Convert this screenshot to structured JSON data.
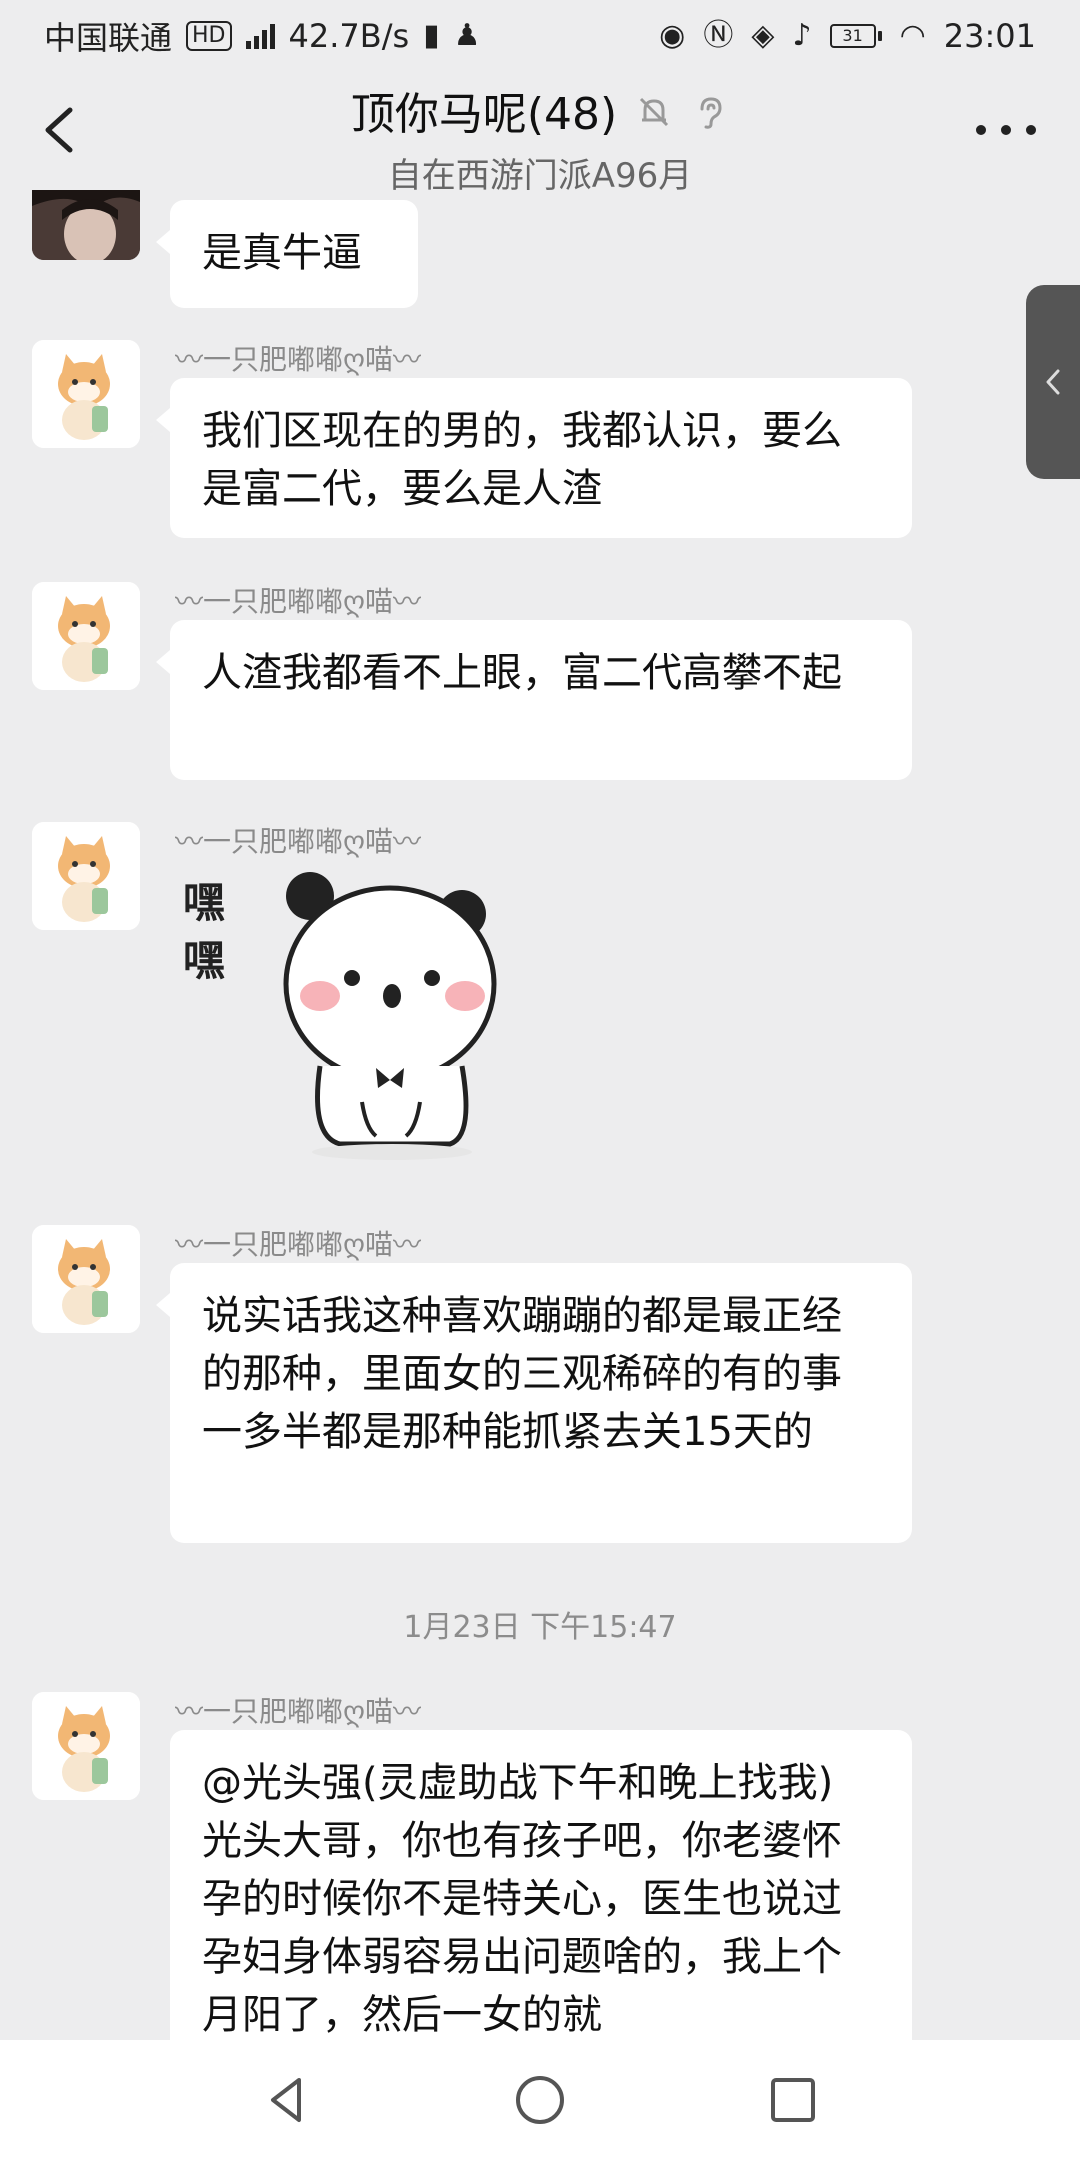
{
  "status_bar": {
    "carrier": "中国联通",
    "hd_badge": "HD",
    "network_speed": "42.7B/s",
    "time": "23:01",
    "battery_level": "31"
  },
  "header": {
    "title": "顶你马呢(48)",
    "subtitle": "自在西游门派A96月"
  },
  "messages": [
    {
      "sender": "",
      "text": "是真牛逼"
    },
    {
      "sender": "〰一只肥嘟嘟ღ喵〰",
      "text": "我们区现在的男的，我都认识，要么是富二代，要么是人渣"
    },
    {
      "sender": "〰一只肥嘟嘟ღ喵〰",
      "text": "人渣我都看不上眼，富二代高攀不起"
    },
    {
      "sender": "〰一只肥嘟嘟ღ喵〰",
      "sticker_text": "嘿嘿"
    },
    {
      "sender": "〰一只肥嘟嘟ღ喵〰",
      "text": "说实话我这种喜欢蹦蹦的都是最正经的那种，里面女的三观稀碎的有的事一多半都是那种能抓紧去关15天的"
    },
    {
      "sender": "〰一只肥嘟嘟ღ喵〰",
      "text": "@光头强(灵虚助战下午和晚上找我) 光头大哥，你也有孩子吧，你老婆怀孕的时候你不是特关心，医生也说过孕妇身体弱容易出问题啥的，我上个月阳了，然后一女的就"
    }
  ],
  "timestamp": "1月23日 下午15:47",
  "icons": {
    "back": "chevron-left-icon",
    "mute": "bell-off-icon",
    "ear": "ear-icon",
    "more": "more-dots-icon",
    "side_tab": "chevron-left-icon",
    "nav_back": "triangle-back-icon",
    "nav_home": "circle-home-icon",
    "nav_recent": "square-recent-icon"
  },
  "colors": {
    "background": "#ededee",
    "bubble": "#ffffff",
    "sender": "#8a8a8a",
    "timestamp": "#8c8c8c"
  }
}
